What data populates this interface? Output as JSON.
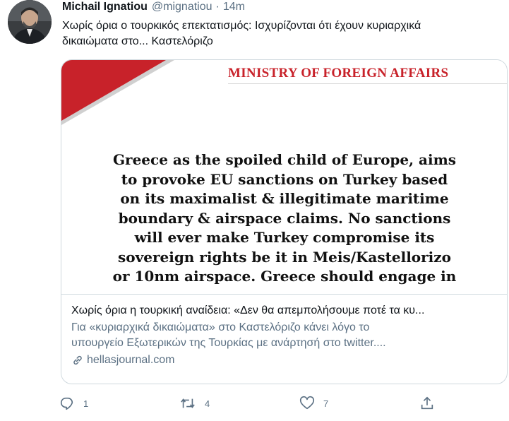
{
  "tweet": {
    "author_name": "Michail Ignatiou",
    "author_handle": "@mignatiou",
    "separator": "·",
    "time": "14m",
    "text_lines": [
      "Χωρίς όρια ο τουρκικός επεκτατισμός:  Ισχυρίζονται ότι έχουν κυριαρχικά",
      "δικαιώματα στο... Καστελόριζο"
    ]
  },
  "card": {
    "image": {
      "header": "MINISTRY OF FOREIGN AFFAIRS",
      "statement_lines": [
        "Greece as the spoiled child of Europe, aims",
        "to provoke EU sanctions on Turkey based",
        "on its maximalist & illegitimate maritime",
        "boundary & airspace claims. No sanctions",
        "will ever make Turkey compromise its",
        "sovereign rights be it in Meis/Kastellorizo",
        "or 10nm airspace. Greece should engage in"
      ],
      "accent_color": "#c8222a"
    },
    "title": "Χωρίς όρια η τουρκική αναίδεια: «Δεν θα απεμπολήσουμε ποτέ τα κυ...",
    "description_lines": [
      "Για «κυριαρχικά δικαιώματα» στο Καστελόριζο κάνει λόγο το",
      "υπουργείο Εξωτερικών της Τουρκίας με ανάρτησή στο twitter...."
    ],
    "domain": "hellasjournal.com",
    "domain_icon": "link-icon"
  },
  "actions": {
    "reply_count": "1",
    "retweet_count": "4",
    "like_count": "7",
    "icons": [
      "reply-icon",
      "retweet-icon",
      "like-icon",
      "share-icon"
    ]
  }
}
